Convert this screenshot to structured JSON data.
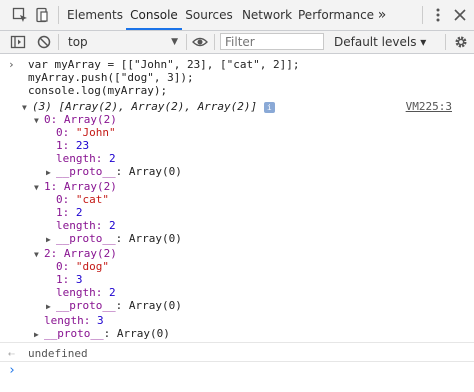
{
  "tabs": {
    "elements": "Elements",
    "console": "Console",
    "sources": "Sources",
    "network": "Network",
    "performance": "Performance",
    "more": "»"
  },
  "toolbar": {
    "context": "top",
    "filter_placeholder": "Filter",
    "levels": "Default levels ▾"
  },
  "code": {
    "line1": "var myArray = [[\"John\", 23], [\"cat\", 2]];",
    "line2": "myArray.push([\"dog\", 3]);",
    "line3": "console.log(myArray);"
  },
  "output": {
    "summary": "(3) [Array(2), Array(2), Array(2)]",
    "summary_info": "i",
    "source": "VM225:3",
    "item0": "0: Array(2)",
    "item0_0_key": "0: ",
    "item0_0_val": "\"John\"",
    "item0_1_key": "1: ",
    "item0_1_val": "23",
    "item0_len_key": "length: ",
    "item0_len_val": "2",
    "item0_proto_key": "__proto__",
    "item0_proto_val": ": Array(0)",
    "item1": "1: Array(2)",
    "item1_0_key": "0: ",
    "item1_0_val": "\"cat\"",
    "item1_1_key": "1: ",
    "item1_1_val": "2",
    "item1_len_key": "length: ",
    "item1_len_val": "2",
    "item1_proto_key": "__proto__",
    "item1_proto_val": ": Array(0)",
    "item2": "2: Array(2)",
    "item2_0_key": "0: ",
    "item2_0_val": "\"dog\"",
    "item2_1_key": "1: ",
    "item2_1_val": "3",
    "item2_len_key": "length: ",
    "item2_len_val": "2",
    "item2_proto_key": "__proto__",
    "item2_proto_val": ": Array(0)",
    "root_len_key": "length: ",
    "root_len_val": "3",
    "root_proto_key": "__proto__",
    "root_proto_val": ": Array(0)"
  },
  "result": "undefined",
  "icons": {
    "inspect": "inspect-element-icon",
    "device": "device-toolbar-icon",
    "kebab": "kebab-menu-icon",
    "close": "close-icon",
    "sidebar": "sidebar-toggle-icon",
    "clear": "clear-console-icon",
    "eye": "eye-icon",
    "gear": "gear-icon"
  },
  "colors": {
    "accent": "#1a73e8",
    "string": "#c41a16",
    "number": "#1c00cf",
    "key": "#881391"
  }
}
